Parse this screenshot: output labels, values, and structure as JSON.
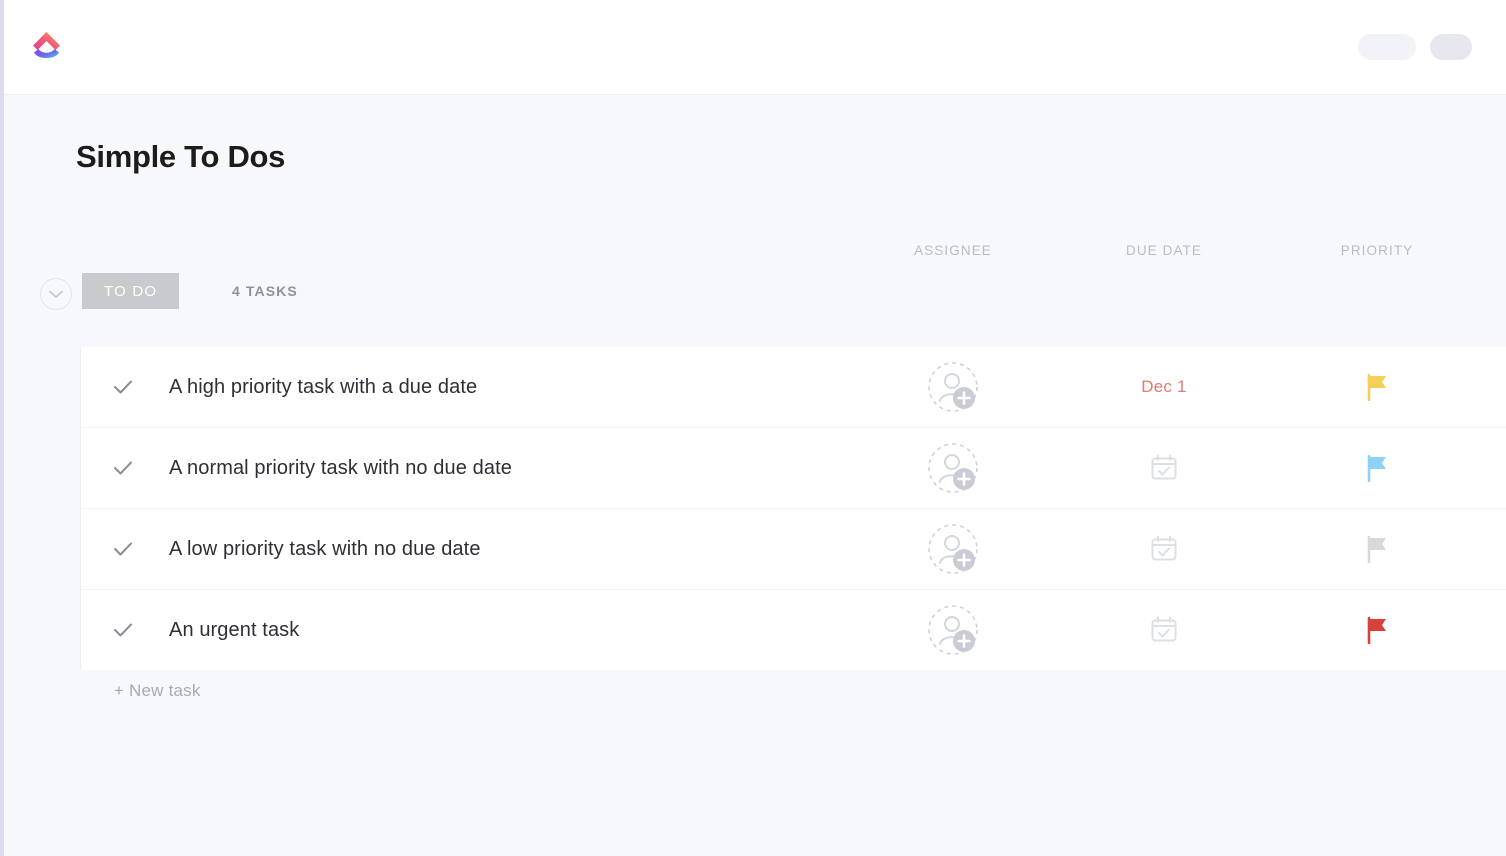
{
  "topbar": {
    "logo_name": "clickup-logo",
    "placeholder_wide": "",
    "placeholder_narrow": ""
  },
  "page": {
    "title": "Simple To Dos"
  },
  "columns": {
    "assignee": "ASSIGNEE",
    "due_date": "DUE DATE",
    "priority": "PRIORITY"
  },
  "group": {
    "collapse_icon": "chevron-down-icon",
    "status": "TO DO",
    "count": "4 TASKS",
    "status_color": "#c9cace"
  },
  "tasks": [
    {
      "name": "A high priority task with a due date",
      "check_icon": "check-icon",
      "assignee": "",
      "assignee_icon": "add-assignee-icon",
      "due_date": "Dec 1",
      "due_icon": "",
      "due_color": "#e07b72",
      "priority": "high",
      "priority_icon": "flag-icon",
      "priority_color": "#f5ce58"
    },
    {
      "name": "A normal priority task with no due date",
      "check_icon": "check-icon",
      "assignee": "",
      "assignee_icon": "add-assignee-icon",
      "due_date": "",
      "due_icon": "calendar-icon",
      "due_color": "#d9dce3",
      "priority": "normal",
      "priority_icon": "flag-icon",
      "priority_color": "#8ed3f7"
    },
    {
      "name": "A low priority task with no due date",
      "check_icon": "check-icon",
      "assignee": "",
      "assignee_icon": "add-assignee-icon",
      "due_date": "",
      "due_icon": "calendar-icon",
      "due_color": "#d9dce3",
      "priority": "low",
      "priority_icon": "flag-icon",
      "priority_color": "#d6d8dd"
    },
    {
      "name": "An urgent task",
      "check_icon": "check-icon",
      "assignee": "",
      "assignee_icon": "add-assignee-icon",
      "due_date": "",
      "due_icon": "calendar-icon",
      "due_color": "#d9dce3",
      "priority": "urgent",
      "priority_icon": "flag-icon",
      "priority_color": "#d6433a"
    }
  ],
  "footer": {
    "new_task": "+ New task"
  }
}
